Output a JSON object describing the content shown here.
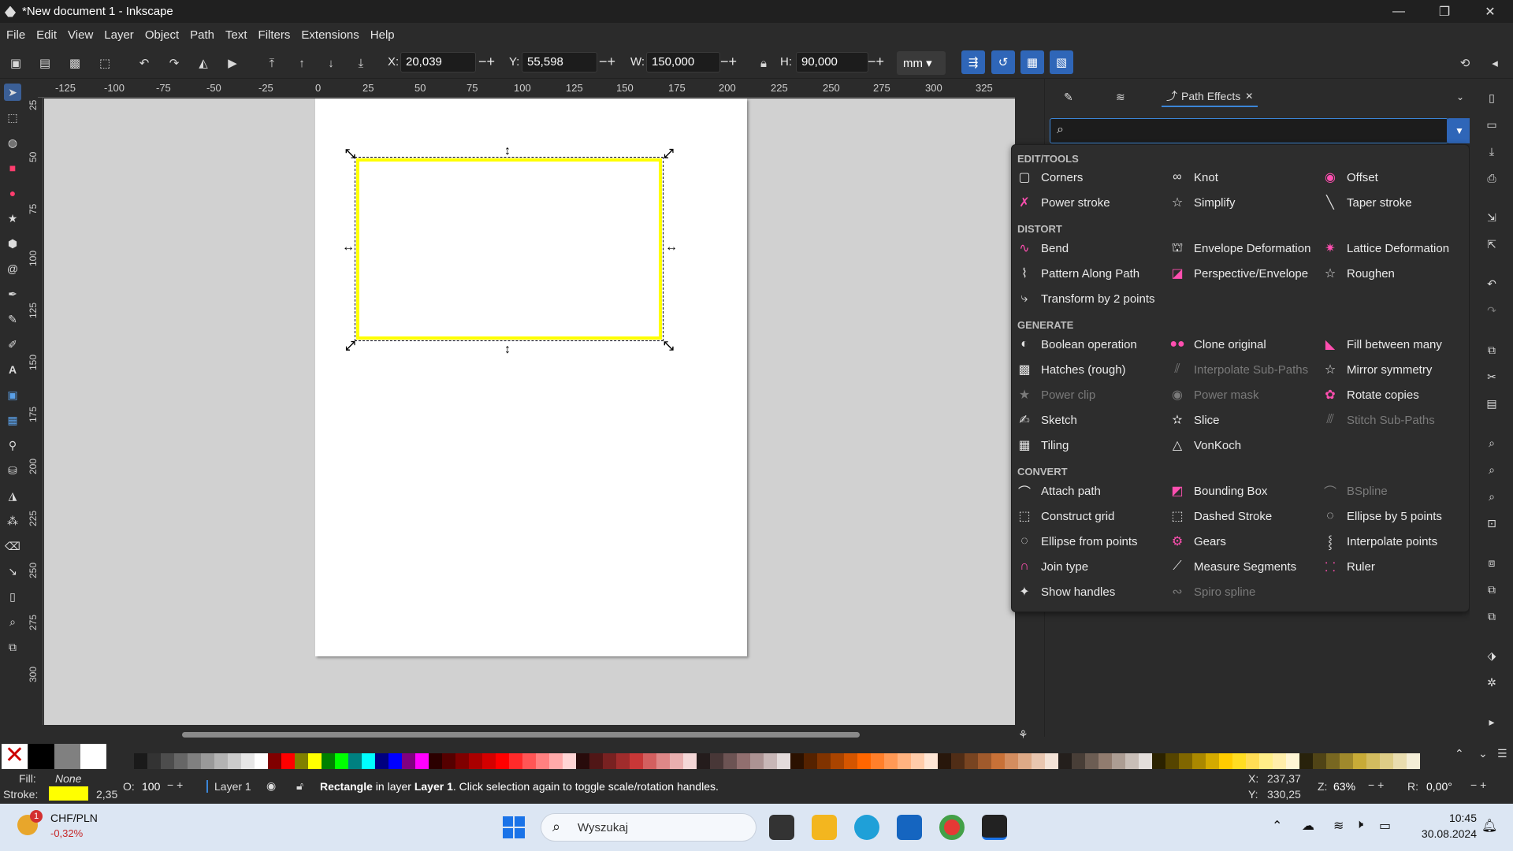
{
  "window": {
    "title": "*New document 1 - Inkscape",
    "minimize": "—",
    "maximize": "❐",
    "close": "✕"
  },
  "menu": [
    "File",
    "Edit",
    "View",
    "Layer",
    "Object",
    "Path",
    "Text",
    "Filters",
    "Extensions",
    "Help"
  ],
  "toolbar": {
    "x_label": "X:",
    "x_value": "20,039",
    "y_label": "Y:",
    "y_value": "55,598",
    "w_label": "W:",
    "w_value": "150,000",
    "h_label": "H:",
    "h_value": "90,000",
    "unit": "mm"
  },
  "ruler": {
    "h_ticks": [
      "-125",
      "-100",
      "-75",
      "-50",
      "-25",
      "0",
      "25",
      "50",
      "75",
      "100",
      "125",
      "150",
      "175",
      "200",
      "225",
      "250",
      "275",
      "300",
      "325"
    ],
    "v_ticks": [
      "25",
      "50",
      "75",
      "100",
      "125",
      "150",
      "175",
      "200",
      "225",
      "250",
      "275",
      "300"
    ]
  },
  "dock": {
    "tab_active": "Path Effects",
    "tab_close": "✕",
    "search_placeholder": ""
  },
  "lpe": {
    "categories": {
      "edit_tools": "EDIT/TOOLS",
      "distort": "DISTORT",
      "generate": "GENERATE",
      "convert": "CONVERT"
    },
    "edit_tools": [
      "Corners",
      "Knot",
      "Offset",
      "Power stroke",
      "Simplify",
      "Taper stroke"
    ],
    "distort": [
      "Bend",
      "Envelope Deformation",
      "Lattice Deformation",
      "Pattern Along Path",
      "Perspective/Envelope",
      "Roughen",
      "Transform by 2 points"
    ],
    "generate": [
      "Boolean operation",
      "Clone original",
      "Fill between many",
      "Hatches (rough)",
      "Interpolate Sub-Paths",
      "Mirror symmetry",
      "Power clip",
      "Power mask",
      "Rotate copies",
      "Sketch",
      "Slice",
      "Stitch Sub-Paths",
      "Tiling",
      "VonKoch"
    ],
    "convert": [
      "Attach path",
      "Bounding Box",
      "BSpline",
      "Construct grid",
      "Dashed Stroke",
      "Ellipse by 5 points",
      "Ellipse from points",
      "Gears",
      "Interpolate points",
      "Join type",
      "Measure Segments",
      "Ruler",
      "Show handles",
      "Spiro spline"
    ]
  },
  "status": {
    "fill_label": "Fill:",
    "fill_value": "None",
    "stroke_label": "Stroke:",
    "stroke_width": "2,35",
    "opacity_label": "O:",
    "opacity_value": "100",
    "layer": "Layer 1",
    "msg_bold": "Rectangle",
    "msg_mid": " in layer ",
    "msg_layer": "Layer 1",
    "msg_rest": ". Click selection again to toggle scale/rotation handles.",
    "cursor_x_label": "X:",
    "cursor_x": "237,37",
    "cursor_y_label": "Y:",
    "cursor_y": "330,25",
    "zoom_label": "Z:",
    "zoom": "63%",
    "rot_label": "R:",
    "rotation": "0,00°"
  },
  "taskbar": {
    "widget_name": "CHF/PLN",
    "widget_value": "-0,32%",
    "widget_badge": "1",
    "search_label": "Wyszukaj",
    "time": "10:45",
    "date": "30.08.2024"
  },
  "colors": {
    "accent": "#2f66b8",
    "selection_stroke": "#ffff00",
    "canvas_bg": "#d1d1d1",
    "lpe_pink": "#ff4fb0"
  }
}
